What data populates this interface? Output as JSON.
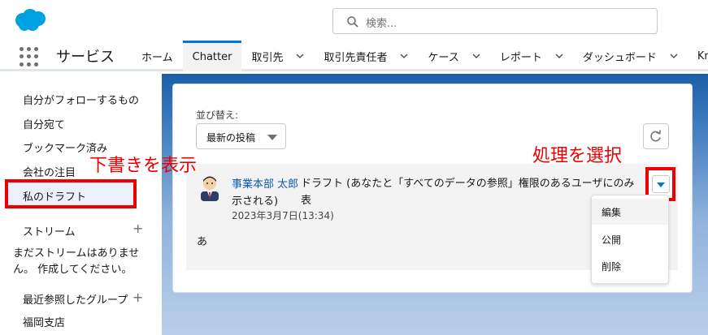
{
  "header": {
    "search_placeholder": "検索..."
  },
  "nav": {
    "app_name": "サービス",
    "tabs": [
      {
        "label": "ホーム",
        "has_menu": false,
        "active": false
      },
      {
        "label": "Chatter",
        "has_menu": false,
        "active": true
      },
      {
        "label": "取引先",
        "has_menu": true,
        "active": false
      },
      {
        "label": "取引先責任者",
        "has_menu": true,
        "active": false
      },
      {
        "label": "ケース",
        "has_menu": true,
        "active": false
      },
      {
        "label": "レポート",
        "has_menu": true,
        "active": false
      },
      {
        "label": "ダッシュボード",
        "has_menu": true,
        "active": false
      },
      {
        "label": "Kno",
        "has_menu": false,
        "active": false
      }
    ]
  },
  "sidebar": {
    "items": [
      {
        "label": "自分がフォローするもの"
      },
      {
        "label": "自分宛て"
      },
      {
        "label": "ブックマーク済み"
      },
      {
        "label": "会社の注目"
      },
      {
        "label": "私のドラフト"
      }
    ],
    "streams_header": "ストリーム",
    "streams_empty_line1": "まだストリームはありませ",
    "streams_empty_line2": "ん。 作成してください。",
    "recent_groups_header": "最近参照したグループ",
    "recent_group_item": "福岡支店"
  },
  "main": {
    "sort_label": "並び替え:",
    "sort_value": "最新の投稿",
    "post": {
      "author": "事業本部 太郎",
      "text_line1": "ドラフト (あなたと「すべてのデータの参照」権限のあるユーザにのみ表",
      "text_line2": "示される)",
      "date": "2023年3月7日(13:34)",
      "body": "あ"
    },
    "menu_items": [
      "編集",
      "公開",
      "削除"
    ]
  },
  "annotations": {
    "drafts_note": "下書きを表示",
    "action_note": "処理を選択"
  },
  "colors": {
    "brand": "#0176d3",
    "annotation_red": "#e00000"
  }
}
